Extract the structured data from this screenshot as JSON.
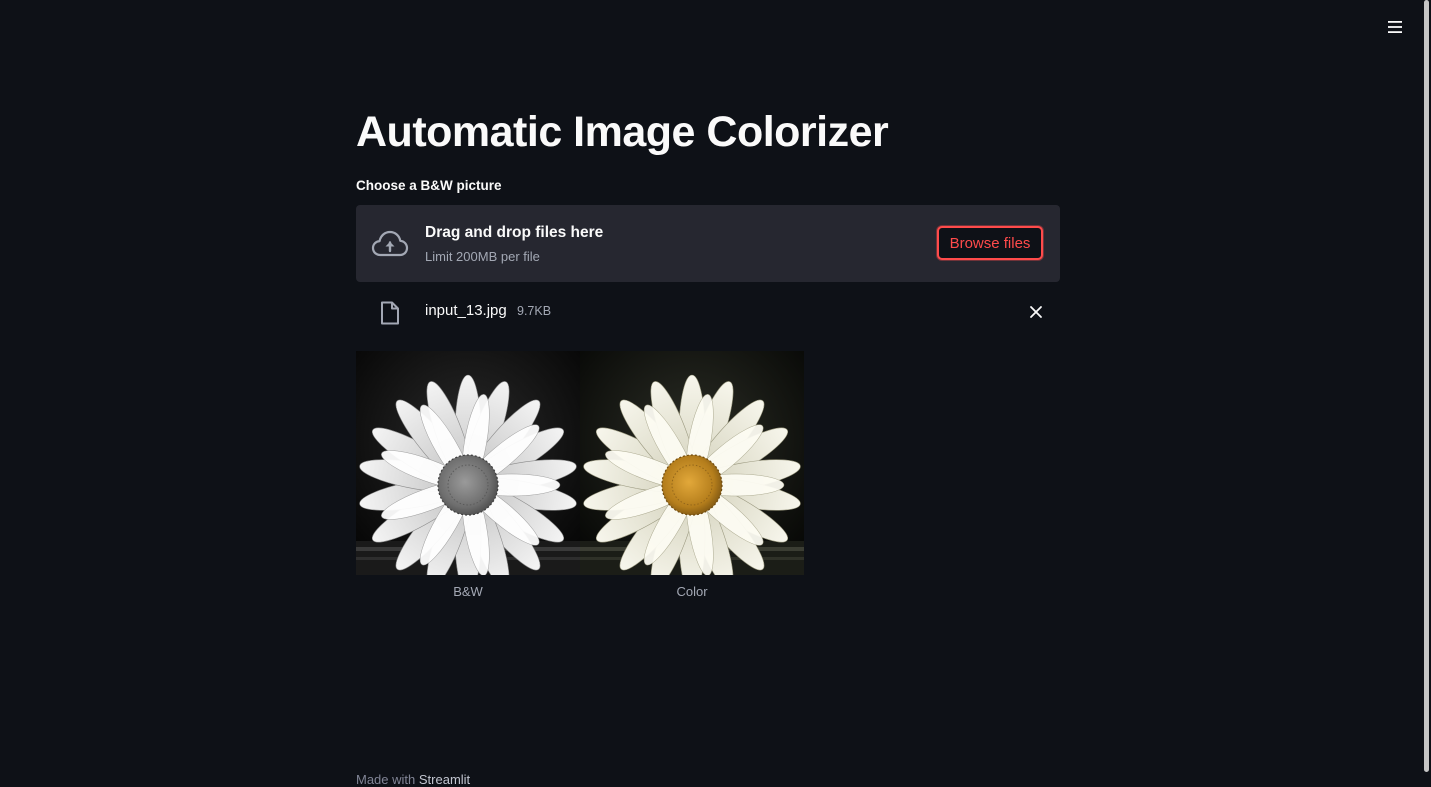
{
  "app": {
    "title": "Automatic Image Colorizer",
    "menu_icon": "hamburger-menu-icon"
  },
  "uploader": {
    "label": "Choose a B&W picture",
    "dropzone_title": "Drag and drop files here",
    "dropzone_limit": "Limit 200MB per file",
    "browse_label": "Browse files",
    "upload_icon": "cloud-upload-icon"
  },
  "uploaded_file": {
    "name": "input_13.jpg",
    "size": "9.7KB",
    "file_icon": "file-icon",
    "remove_icon": "close-icon"
  },
  "images": [
    {
      "caption": "B&W"
    },
    {
      "caption": "Color"
    }
  ],
  "footer": {
    "prefix": "Made with",
    "brand": "Streamlit"
  },
  "colors": {
    "background": "#0e1117",
    "dropzone": "#262730",
    "accent": "#ff4b4b",
    "text": "#fafafa",
    "muted_text": "#a3a8b4"
  }
}
